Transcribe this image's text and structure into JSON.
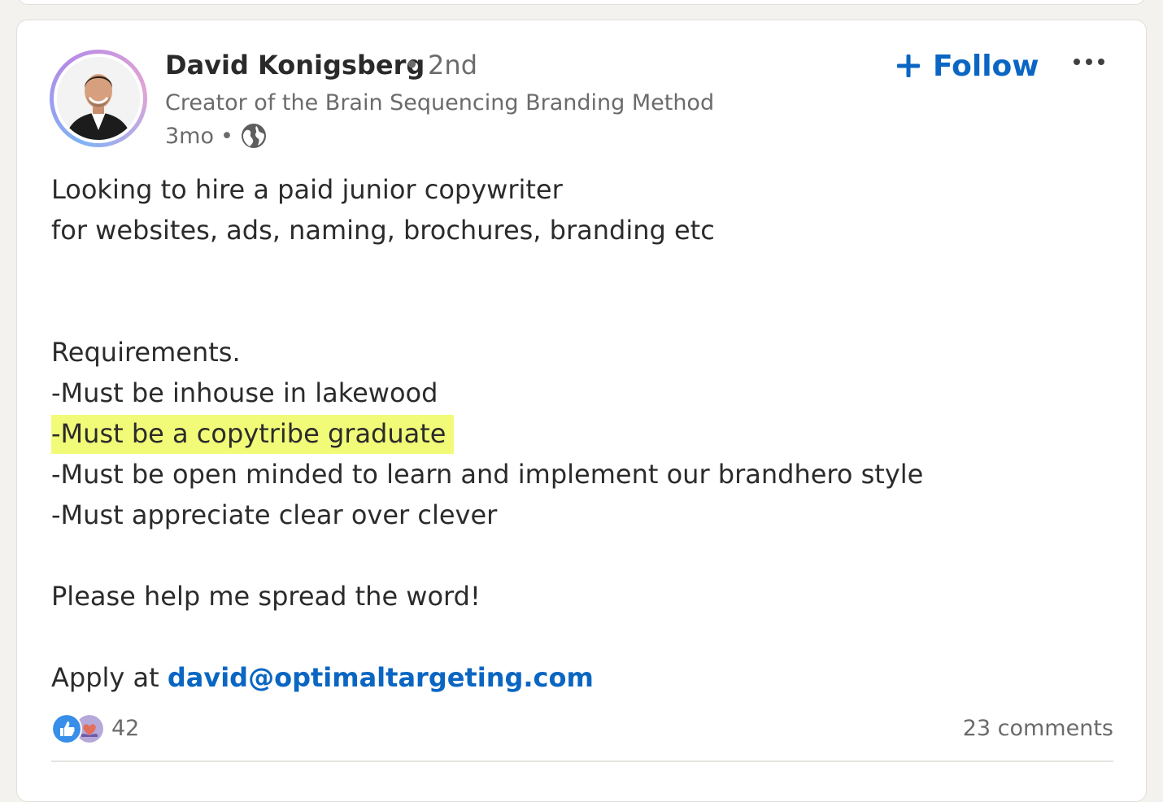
{
  "post": {
    "author": {
      "name": "David Konigsberg",
      "degree": "• 2nd",
      "headline": "Creator of the Brain Sequencing Branding Method",
      "time": "3mo",
      "separator": "•",
      "visibility_icon": "globe-icon"
    },
    "follow": {
      "label": "Follow",
      "icon": "plus-icon"
    },
    "more_icon": "more-options-icon",
    "body": {
      "line1": "Looking to hire a paid junior copywriter",
      "line2": "for websites, ads, naming, brochures, branding etc",
      "req_heading": "Requirements.",
      "req1": "-Must be inhouse in lakewood",
      "req2_highlighted": "-Must be a copytribe graduate",
      "req3": "-Must be open minded to learn and implement our brandhero style",
      "req4": "-Must appreciate clear over clever",
      "cta": "Please help me spread the word!",
      "apply_prefix": "Apply at ",
      "apply_email": "david@optimaltargeting.com"
    },
    "social": {
      "reaction_icons": [
        "like-icon",
        "love-icon"
      ],
      "reaction_count": "42",
      "comments": "23 comments"
    }
  },
  "colors": {
    "accent": "#0a66c2",
    "highlight": "#f2fb78",
    "page_bg": "#f4f2ee"
  }
}
